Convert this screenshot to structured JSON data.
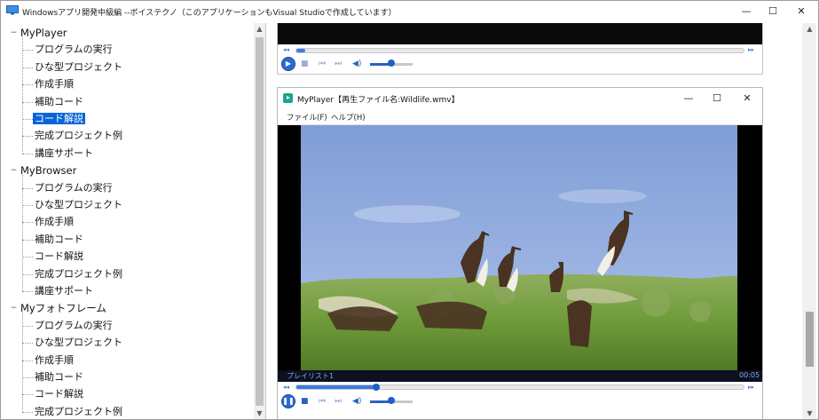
{
  "window": {
    "title": "Windowsアプリ開発中級編 --ボイステクノ（このアプリケーションもVisual Studioで作成しています）",
    "controls": {
      "minimize": "—",
      "maximize": "☐",
      "close": "✕"
    }
  },
  "tree": {
    "groups": [
      {
        "label": "MyPlayer",
        "expander": "−",
        "items": [
          "プログラムの実行",
          "ひな型プロジェクト",
          "作成手順",
          "補助コード",
          "コード解説",
          "完成プロジェクト例",
          "講座サポート"
        ]
      },
      {
        "label": "MyBrowser",
        "expander": "−",
        "items": [
          "プログラムの実行",
          "ひな型プロジェクト",
          "作成手順",
          "補助コード",
          "コード解説",
          "完成プロジェクト例",
          "講座サポート"
        ]
      },
      {
        "label": "Myフォトフレーム",
        "expander": "−",
        "items": [
          "プログラムの実行",
          "ひな型プロジェクト",
          "作成手順",
          "補助コード",
          "コード解説",
          "完成プロジェクト例"
        ]
      }
    ],
    "selected": "MyPlayer/コード解説"
  },
  "player": {
    "title": "MyPlayer【再生ファイル名:Wildlife.wmv】",
    "menu": {
      "file": "ファイル(F)",
      "help": "ヘルプ(H)"
    },
    "playlist_label": "プレイリスト1",
    "time": "00:05",
    "seek_progress": 0.18,
    "volume": 0.5
  },
  "top_player": {
    "seek_progress": 0.02,
    "volume": 0.5
  },
  "icons": {
    "app": "monitor-icon",
    "play_pause": "pause-icon",
    "stop": "stop-icon",
    "prev": "skip-previous-icon",
    "next": "skip-next-icon",
    "volume": "speaker-icon",
    "rewind": "rewind-icon",
    "forward": "fast-forward-icon"
  },
  "colors": {
    "accent": "#0a64d8",
    "player_blue": "#2b62c2",
    "player_icon": "#1aa58c"
  }
}
